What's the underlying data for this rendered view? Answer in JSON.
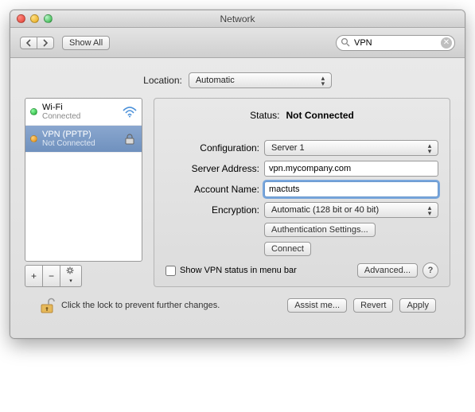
{
  "window": {
    "title": "Network"
  },
  "toolbar": {
    "show_all": "Show All"
  },
  "search": {
    "placeholder": "",
    "value": "VPN"
  },
  "location": {
    "label": "Location:",
    "value": "Automatic"
  },
  "sidebar": {
    "items": [
      {
        "name": "Wi-Fi",
        "status": "Connected"
      },
      {
        "name": "VPN (PPTP)",
        "status": "Not Connected"
      }
    ]
  },
  "detail": {
    "status_label": "Status:",
    "status_value": "Not Connected",
    "config_label": "Configuration:",
    "config_value": "Server 1",
    "server_label": "Server Address:",
    "server_value": "vpn.mycompany.com",
    "account_label": "Account Name:",
    "account_value": "mactuts",
    "encryption_label": "Encryption:",
    "encryption_value": "Automatic (128 bit or 40 bit)",
    "auth_button": "Authentication Settings...",
    "connect_button": "Connect",
    "show_status_checkbox": "Show VPN status in menu bar",
    "advanced_button": "Advanced...",
    "help_button": "?"
  },
  "footer": {
    "lock_text": "Click the lock to prevent further changes.",
    "assist": "Assist me...",
    "revert": "Revert",
    "apply": "Apply"
  }
}
